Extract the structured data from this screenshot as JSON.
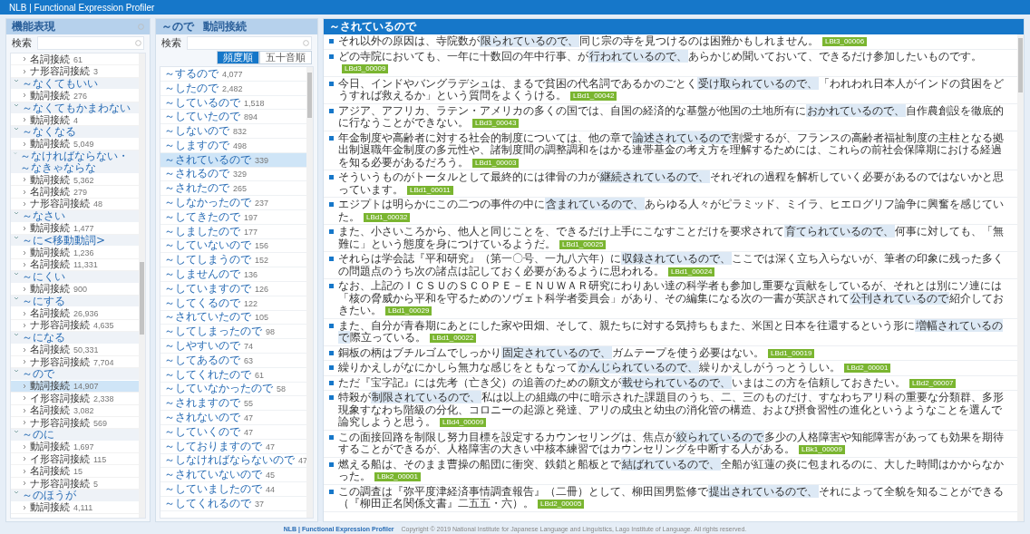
{
  "app_title": "NLB | Functional Expression Profiler",
  "left_panel": {
    "title": "機能表現",
    "search": {
      "label": "検索"
    },
    "tree": [
      {
        "children": [
          {
            "label": "名詞接続",
            "count": "61",
            "expanded": false
          },
          {
            "label": "ナ形容詞接続",
            "count": "3",
            "expanded": false
          }
        ]
      },
      {
        "label": "～なくてもいい",
        "expanded": true,
        "children": [
          {
            "label": "動詞接続",
            "count": "276",
            "expanded": false
          }
        ]
      },
      {
        "label": "～なくてもかまわない",
        "expanded": true,
        "children": [
          {
            "label": "動詞接続",
            "count": "4",
            "expanded": false
          }
        ]
      },
      {
        "label": "～なくなる",
        "expanded": true,
        "children": [
          {
            "label": "動詞接続",
            "count": "5,049",
            "expanded": false
          }
        ]
      },
      {
        "label": "～なければならない・～なきゃならな",
        "expanded": true,
        "children": [
          {
            "label": "動詞接続",
            "count": "5,362",
            "expanded": false
          },
          {
            "label": "名詞接続",
            "count": "279",
            "expanded": false
          },
          {
            "label": "ナ形容詞接続",
            "count": "48",
            "expanded": false
          }
        ]
      },
      {
        "label": "～なさい",
        "expanded": true,
        "children": [
          {
            "label": "動詞接続",
            "count": "1,477",
            "expanded": false
          }
        ]
      },
      {
        "label": "～に<移動動詞>",
        "expanded": true,
        "children": [
          {
            "label": "動詞接続",
            "count": "1,236",
            "expanded": false
          },
          {
            "label": "名詞接続",
            "count": "11,331",
            "expanded": false
          }
        ]
      },
      {
        "label": "～にくい",
        "expanded": true,
        "children": [
          {
            "label": "動詞接続",
            "count": "900",
            "expanded": false
          }
        ]
      },
      {
        "label": "～にする",
        "expanded": true,
        "children": [
          {
            "label": "名詞接続",
            "count": "26,936",
            "expanded": false
          },
          {
            "label": "ナ形容詞接続",
            "count": "4,635",
            "expanded": false
          }
        ]
      },
      {
        "label": "～になる",
        "expanded": true,
        "children": [
          {
            "label": "名詞接続",
            "count": "50,331",
            "expanded": false
          },
          {
            "label": "ナ形容詞接続",
            "count": "7,704",
            "expanded": false
          }
        ]
      },
      {
        "label": "～ので",
        "expanded": true,
        "children": [
          {
            "label": "動詞接続",
            "count": "14,907",
            "expanded": false,
            "selected": true
          },
          {
            "label": "イ形容詞接続",
            "count": "2,338",
            "expanded": false,
            "selected": false
          },
          {
            "label": "名詞接続",
            "count": "3,082",
            "expanded": false,
            "selected": false
          },
          {
            "label": "ナ形容詞接続",
            "count": "569",
            "expanded": false,
            "selected": false
          }
        ]
      },
      {
        "label": "～のに",
        "expanded": true,
        "children": [
          {
            "label": "動詞接続",
            "count": "1,697",
            "expanded": false
          },
          {
            "label": "イ形容詞接続",
            "count": "115",
            "expanded": false
          },
          {
            "label": "名詞接続",
            "count": "15",
            "expanded": false
          },
          {
            "label": "ナ形容詞接続",
            "count": "5",
            "expanded": false
          }
        ]
      },
      {
        "label": "～のほうが",
        "expanded": true,
        "children": [
          {
            "label": "動詞接続",
            "count": "4,111",
            "expanded": false
          }
        ]
      }
    ]
  },
  "middle_panel": {
    "title": "～ので",
    "subtitle": "動詞接続",
    "search": {
      "label": "検索"
    },
    "sort_buttons": [
      {
        "label": "頻度順",
        "selected": true
      },
      {
        "label": "五十音順",
        "selected": false
      }
    ],
    "items": [
      {
        "label": "～するので",
        "count": "4,077",
        "selected": false
      },
      {
        "label": "～したので",
        "count": "2,482",
        "selected": false
      },
      {
        "label": "～しているので",
        "count": "1,518",
        "selected": false
      },
      {
        "label": "～していたので",
        "count": "894",
        "selected": false
      },
      {
        "label": "～しないので",
        "count": "832",
        "selected": false
      },
      {
        "label": "～しますので",
        "count": "498",
        "selected": false
      },
      {
        "label": "～されているので",
        "count": "339",
        "selected": true
      },
      {
        "label": "～されるので",
        "count": "329",
        "selected": false
      },
      {
        "label": "～されたので",
        "count": "265",
        "selected": false
      },
      {
        "label": "～しなかったので",
        "count": "237",
        "selected": false
      },
      {
        "label": "～してきたので",
        "count": "197",
        "selected": false
      },
      {
        "label": "～しましたので",
        "count": "177",
        "selected": false
      },
      {
        "label": "～していないので",
        "count": "156",
        "selected": false
      },
      {
        "label": "～してしまうので",
        "count": "152",
        "selected": false
      },
      {
        "label": "～しませんので",
        "count": "136",
        "selected": false
      },
      {
        "label": "～していますので",
        "count": "126",
        "selected": false
      },
      {
        "label": "～してくるので",
        "count": "122",
        "selected": false
      },
      {
        "label": "～されていたので",
        "count": "105",
        "selected": false
      },
      {
        "label": "～してしまったので",
        "count": "98",
        "selected": false
      },
      {
        "label": "～しやすいので",
        "count": "74",
        "selected": false
      },
      {
        "label": "～してあるので",
        "count": "63",
        "selected": false
      },
      {
        "label": "～してくれたので",
        "count": "61",
        "selected": false
      },
      {
        "label": "～していなかったので",
        "count": "58",
        "selected": false
      },
      {
        "label": "～されますので",
        "count": "55",
        "selected": false
      },
      {
        "label": "～されないので",
        "count": "47",
        "selected": false
      },
      {
        "label": "～していくので",
        "count": "47",
        "selected": false
      },
      {
        "label": "～しておりますので",
        "count": "47",
        "selected": false
      },
      {
        "label": "～しなければならないので",
        "count": "47",
        "selected": false
      },
      {
        "label": "～されていないので",
        "count": "45",
        "selected": false
      },
      {
        "label": "～していましたので",
        "count": "44",
        "selected": false
      },
      {
        "label": "～してくれるので",
        "count": "37",
        "selected": false
      }
    ]
  },
  "examples_panel": {
    "title": "～されているので",
    "examples": [
      {
        "before": "それ以外の原因は、寺院数が",
        "match": "限られているので、",
        "after": "同じ宗の寺を見つけるのは困難かもしれません。",
        "source": "LBt3_00006"
      },
      {
        "before": "どの寺院においても、一年に十数回の年中行事、が",
        "match": "行われているので、",
        "after": "あらかじめ聞いておいて、できるだけ参加したいものです。",
        "source": "LBd3_00009"
      },
      {
        "before": "今日、インドやバングラデシュは、まるで貧困の代名詞であるかのごとく",
        "match": "受け取られているので、",
        "after": "「われわれ日本人がインドの貧困をどうすれば救えるか」という質問をよくうける。",
        "source": "LBd1_00042"
      },
      {
        "before": "アジア、アフリカ、ラテン・アメリカの多くの国では、自国の経済的な基盤が他国の土地所有に",
        "match": "おかれているので、",
        "after": "自作農創設を徹底的に行なうことができない。",
        "source": "LBd3_00043"
      },
      {
        "before": "年金制度や高齢者に対する社会的制度については、他の章で",
        "match": "論述されているので",
        "after": "割愛するが、フランスの高齢者福祉制度の主柱となる拠出制退職年金制度の多元性や、諸制度間の調整調和をはかる連帯基金の考え方を理解するためには、これらの前社会保障期における経過を知る必要があるだろう。",
        "source": "LBd1_00003"
      },
      {
        "before": "そういうものがトータルとして最終的には律骨の力が",
        "match": "継続されているので、",
        "after": "それぞれの過程を解析していく必要があるのではないかと思っています。",
        "source": "LBd1_00011"
      },
      {
        "before": "エジプトは明らかにこの二つの事件の中に",
        "match": "含まれているので、",
        "after": "あらゆる人々がピラミッド、ミイラ、ヒエログリフ論争に興奮を感じていた。",
        "source": "LBd1_00032"
      },
      {
        "before": "また、小さいころから、他人と同じことを、できるだけ上手にこなすことだけを要求されて",
        "match": "育てられているので、",
        "after": "何事に対しても、「無難に」という態度を身につけているようだ。",
        "source": "LBd1_00025"
      },
      {
        "before": "それらは学会誌『平和研究』（第一〇号、一九八六年）に",
        "match": "収録されているので、",
        "after": "ここでは深く立ち入らないが、筆者の印象に残った多くの問題点のうち次の諸点は記しておく必要があるように思われる。",
        "source": "LBd1_00024"
      },
      {
        "before": "なお、上記のＩＣＳＵのＳＣＯＰＥ－ＥＮＵＷＡＲ研究にわりあい達の科学者も参加し重要な貢献をしているが、それとは別にソ連には「核の脅威から平和を守るためのソヴェト科学者委員会」があり、その編集になる次の一書が英訳されて",
        "match": "公刊されているので",
        "after": "紹介しておきたい。",
        "source": "LBd1_00029"
      },
      {
        "before": "また、自分が青春期にあとにした家や田畑、そして、親たちに対する気持ちもまた、米国と日本を往還するという形に",
        "match": "増幅されているので",
        "after": "際立っている。",
        "source": "LBd1_00022"
      },
      {
        "before": "銅板の柄はブチルゴムでしっかり",
        "match": "固定されているので、",
        "after": "ガムテープを使う必要はない。",
        "source": "LBd1_00019"
      },
      {
        "before": "繰りかえしがなにかしら無力な感じをともなって",
        "match": "かんじられているので、",
        "after": "繰りかえしがうっとうしい。",
        "source": "LBd2_00001"
      },
      {
        "before": "ただ『宝字記』には先考（亡き父）の追善のための願文が",
        "match": "載せられているので、",
        "after": "いまはこの方を信頼しておきたい。",
        "source": "LBd2_00007"
      },
      {
        "before": "特殺が",
        "match": "制限されているので、",
        "after": "私は以上の組織の中に暗示された課題目のうち、二、三のものだけ、すなわちアリ科の重要な分類群、多形現象すなわち階級の分化、コロニーの起源と発達、アリの成虫と幼虫の消化管の構造、および摂食習性の進化というようなことを選んで論究しようと思う。",
        "source": "LBd4_00009"
      },
      {
        "before": "この面接回路を制限し努力目標を設定するカウンセリングは、焦点が",
        "match": "絞られているので",
        "after": "多少の人格障害や知能障害があっても効果を期待することができるが、人格障害の大きい中核本練習ではカウンセリングを中断する人がある。",
        "source": "LBk1_00009"
      },
      {
        "before": "燃える船は、そのまま曹操の船団に衝突、鉄鎖と船板とで",
        "match": "結ばれているので、",
        "after": "全船が紅蓮の炎に包まれるのに、大した時間はかからなかった。",
        "source": "LBk2_00001"
      },
      {
        "before": "この調査は『弥平度津経済事情調査報告』（二冊）として、柳田国男監修で",
        "match": "提出されているので、",
        "after": "それによって全貌を知ることができる（『柳田正名関係文書』二五五・六）。",
        "source": "LBd2_00005"
      }
    ]
  },
  "footer": {
    "brand": "NLB | Functional Expression Profiler",
    "copyright": "Copyright © 2019 National Institute for Japanese Language and Linguistics, Lago Institute of Language. All rights reserved."
  }
}
